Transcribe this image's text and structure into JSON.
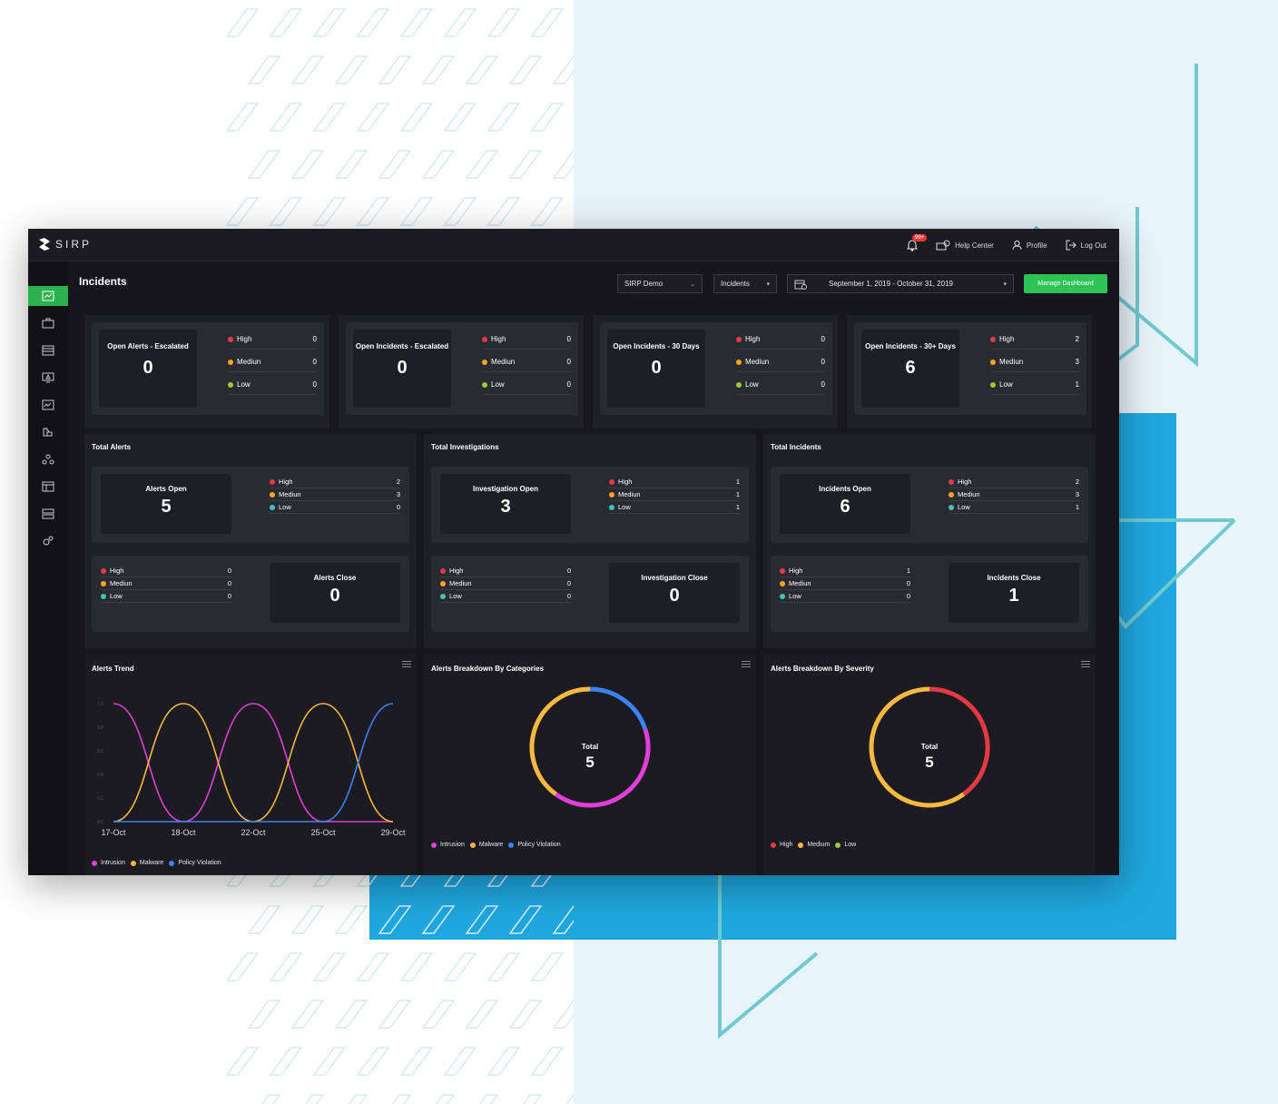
{
  "brand": {
    "name": "SIRP"
  },
  "topbar": {
    "notifications_badge": "99+",
    "help_label": "Help Center",
    "profile_label": "Profile",
    "logout_label": "Log Out"
  },
  "page": {
    "title": "Incidents"
  },
  "filters": {
    "workspace": "SIRP Demo",
    "type": "Incidents",
    "date_range": "September 1, 2019 - October 31, 2019",
    "manage_label": "Manage Dashboard"
  },
  "colors": {
    "high": "#e63946",
    "medium": "#f5a623",
    "low": "#9acd32",
    "low_teal": "#3dc9b0",
    "accent": "#2fc256"
  },
  "severity_labels": {
    "high": "High",
    "medium": "Mediun",
    "low": "Low"
  },
  "kpis": [
    {
      "title": "Open Alerts - Escalated",
      "value": "0",
      "high": "0",
      "medium": "0",
      "low": "0"
    },
    {
      "title": "Open Incidents - Escalated",
      "value": "0",
      "high": "0",
      "medium": "0",
      "low": "0"
    },
    {
      "title": "Open Incidents - 30 Days",
      "value": "0",
      "high": "0",
      "medium": "0",
      "low": "0"
    },
    {
      "title": "Open Incidents - 30+ Days",
      "value": "6",
      "high": "2",
      "medium": "3",
      "low": "1"
    }
  ],
  "totals": [
    {
      "title": "Total Alerts",
      "open_label": "Alerts Open",
      "open_value": "5",
      "open_high": "2",
      "open_medium": "3",
      "open_low": "0",
      "close_label": "Alerts Close",
      "close_value": "0",
      "close_high": "0",
      "close_medium": "0",
      "close_low": "0"
    },
    {
      "title": "Total Investigations",
      "open_label": "Investigation Open",
      "open_value": "3",
      "open_high": "1",
      "open_medium": "1",
      "open_low": "1",
      "close_label": "Investigation Close",
      "close_value": "0",
      "close_high": "0",
      "close_medium": "0",
      "close_low": "0"
    },
    {
      "title": "Total Incidents",
      "open_label": "Incidents Open",
      "open_value": "6",
      "open_high": "2",
      "open_medium": "3",
      "open_low": "1",
      "close_label": "Incidents Close",
      "close_value": "1",
      "close_high": "1",
      "close_medium": "0",
      "close_low": "0"
    }
  ],
  "trend": {
    "title": "Alerts Trend",
    "legend": [
      "Intrusion",
      "Malware",
      "Policy Violation"
    ]
  },
  "categories": {
    "title": "Alerts Breakdown By Categories",
    "total_label": "Total",
    "total_value": "5",
    "legend": [
      "Intrusion",
      "Malware",
      "Policy Violation"
    ]
  },
  "severity": {
    "title": "Alerts Breakdown By Severity",
    "total_label": "Total",
    "total_value": "5",
    "legend": [
      "High",
      "Medium",
      "Low"
    ]
  },
  "chart_data": [
    {
      "type": "line",
      "title": "Alerts Trend",
      "categories": [
        "17-Oct",
        "18-Oct",
        "22-Oct",
        "25-Oct",
        "29-Oct"
      ],
      "ylim": [
        0,
        1
      ],
      "series": [
        {
          "name": "Intrusion",
          "color": "#e040d8",
          "values": [
            1,
            0,
            1,
            0,
            0
          ]
        },
        {
          "name": "Malware",
          "color": "#f5b942",
          "values": [
            0,
            1,
            0,
            1,
            0
          ]
        },
        {
          "name": "Policy Violation",
          "color": "#3b82f6",
          "values": [
            0,
            0,
            0,
            0,
            1
          ]
        }
      ]
    },
    {
      "type": "pie",
      "title": "Alerts Breakdown By Categories",
      "labels": [
        "Intrusion",
        "Malware",
        "Policy Violation"
      ],
      "values": [
        2,
        2,
        1
      ],
      "colors": [
        "#e040d8",
        "#f5b942",
        "#3b82f6"
      ]
    },
    {
      "type": "pie",
      "title": "Alerts Breakdown By Severity",
      "labels": [
        "High",
        "Medium",
        "Low"
      ],
      "values": [
        2,
        3,
        0
      ],
      "colors": [
        "#e63946",
        "#f5b942",
        "#9acd32"
      ]
    }
  ]
}
